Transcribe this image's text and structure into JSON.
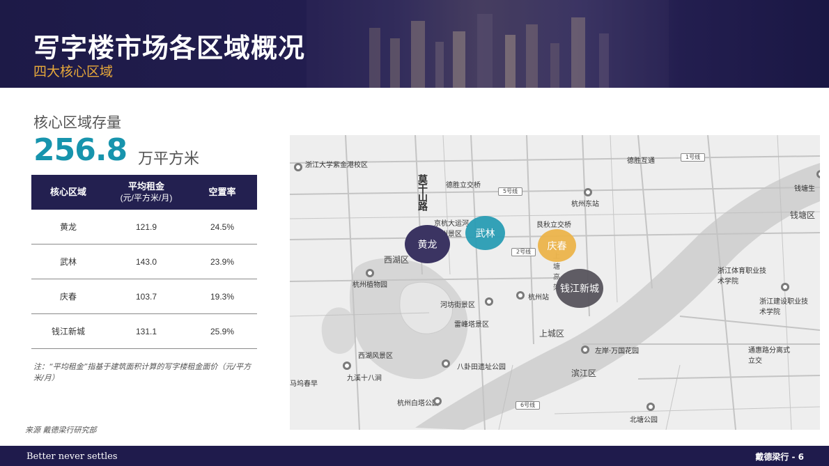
{
  "header": {
    "title": "写字楼市场各区域概况",
    "subtitle": "四大核心区域"
  },
  "stock": {
    "label": "核心区域存量",
    "value": "256.8",
    "unit": "万平方米"
  },
  "table": {
    "col1": "核心区域",
    "col2_line1": "平均租金",
    "col2_line2": "(元/平方米/月)",
    "col3": "空置率",
    "rows": [
      {
        "area": "黄龙",
        "rent": "121.9",
        "vacancy": "24.5%"
      },
      {
        "area": "武林",
        "rent": "143.0",
        "vacancy": "23.9%"
      },
      {
        "area": "庆春",
        "rent": "103.7",
        "vacancy": "19.3%"
      },
      {
        "area": "钱江新城",
        "rent": "131.1",
        "vacancy": "25.9%"
      }
    ]
  },
  "note": "注：“平均租金”指基于建筑面积计算的写字楼租金面价（元/平方米/月）",
  "source": "来源 戴德梁行研究部",
  "map": {
    "bubbles": {
      "huanglong": "黄龙",
      "wulin": "武林",
      "qingchun": "庆春",
      "qianjiang": "钱江新城"
    },
    "labels": {
      "zju": "浙江大学紫金港校区",
      "deshenghutong": "德胜互通",
      "line1": "1号线",
      "deshengli": "德胜立交桥",
      "line5": "5号线",
      "hangzhoudongzhan": "杭州东站",
      "qiantang": "钱塘生",
      "qiantang2": "钱塘区",
      "moganshan": "莫干山路",
      "jinghang": "京杭大运河杭州景区",
      "genqi": "艮秋立交桥",
      "line2": "2号线",
      "xihu": "西湖区",
      "zhiwuyuan": "杭州植物园",
      "sports": "浙江体育职业技术学院",
      "jianshe": "浙江建设职业技术学院",
      "shangtang": "上塘高架",
      "hefang": "河坊街景区",
      "hangzhouzhan": "杭州站",
      "leifeng": "雷峰塔景区",
      "shangcheng": "上城区",
      "zuoan": "左岸·万国花园",
      "xihufengjing": "西湖风景区",
      "bagua": "八卦田遗址公园",
      "tonghui": "通惠路分离式立交",
      "jiuxi": "九溪十八涧",
      "binjiang": "滨江区",
      "chunzao": "马坞春早",
      "baita": "杭州白塔公园",
      "line6": "6号线",
      "beitang": "北塘公园"
    }
  },
  "footer": {
    "tagline": "Better never settles",
    "page": "戴德梁行 - 6"
  }
}
